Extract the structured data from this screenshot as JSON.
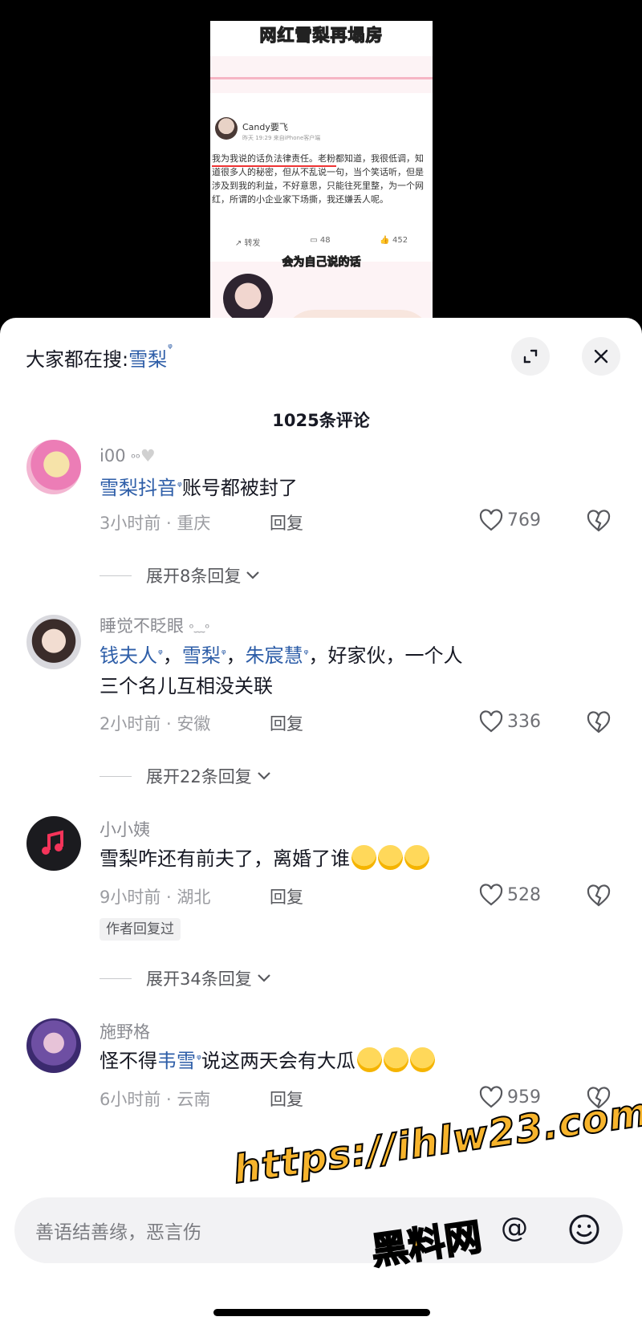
{
  "video": {
    "headline": "网红雪梨再塌房",
    "weibo_name": "Candy要飞",
    "weibo_meta": "昨天 19:29  来自iPhone客户端",
    "weibo_text": "我为我说的话负法律责任。老粉都知道，我很低调，知道很多人的秘密，但从不乱说一句，当个笑话听，但是涉及到我的利益，不好意思，只能往死里整，为一个网红，所谓的小企业家下场撕，我还嫌丢人呢。",
    "actions": {
      "repost": "转发",
      "comments": "48",
      "likes": "452"
    },
    "caption": "会为自己说的话"
  },
  "sheet": {
    "search_prefix": "大家都在搜:",
    "search_keyword": "雪梨",
    "comment_count": "1025条评论"
  },
  "comments": [
    {
      "user": "i00",
      "segments": [
        {
          "text": "雪梨抖音",
          "link": true
        },
        {
          "text": "账号都被封了",
          "link": false
        }
      ],
      "time_loc": "3小时前 · 重庆",
      "reply": "回复",
      "likes": "769",
      "expand": "展开8条回复"
    },
    {
      "user": "睡觉不眨眼",
      "line1": [
        {
          "text": "钱夫人",
          "link": true
        },
        {
          "text": "，",
          "link": false
        },
        {
          "text": "雪梨",
          "link": true
        },
        {
          "text": "，",
          "link": false
        },
        {
          "text": "朱宸慧",
          "link": true
        },
        {
          "text": "，好家伙，一个人",
          "link": false
        }
      ],
      "line2": "三个名儿互相没关联",
      "time_loc": "2小时前 · 安徽",
      "reply": "回复",
      "likes": "336",
      "expand": "展开22条回复"
    },
    {
      "user": "小小姨",
      "text": "雪梨咋还有前夫了，离婚了谁",
      "time_loc": "9小时前 · 湖北",
      "reply": "回复",
      "likes": "528",
      "author_tag": "作者回复过",
      "expand": "展开34条回复"
    },
    {
      "user": "施野格",
      "segments": [
        {
          "text": "怪不得",
          "link": false
        },
        {
          "text": "韦雪",
          "link": true
        },
        {
          "text": "说这两天会有大瓜",
          "link": false
        }
      ],
      "time_loc": "6小时前 · 云南",
      "reply": "回复",
      "likes": "959"
    }
  ],
  "input": {
    "placeholder": "善语结善缘，恶言伤"
  },
  "watermark": {
    "url": "https://ihlw23.com",
    "name": "黑料网"
  },
  "colors": {
    "link": "#2e5ea8",
    "text": "#161823",
    "meta": "#9b9ca1",
    "watermark": "#f7b42c"
  },
  "icons": [
    "expand-icon",
    "close-icon",
    "heart-icon",
    "broken-heart-icon",
    "chevron-down-icon",
    "at-icon",
    "emoji-icon",
    "search-hint-icon"
  ]
}
